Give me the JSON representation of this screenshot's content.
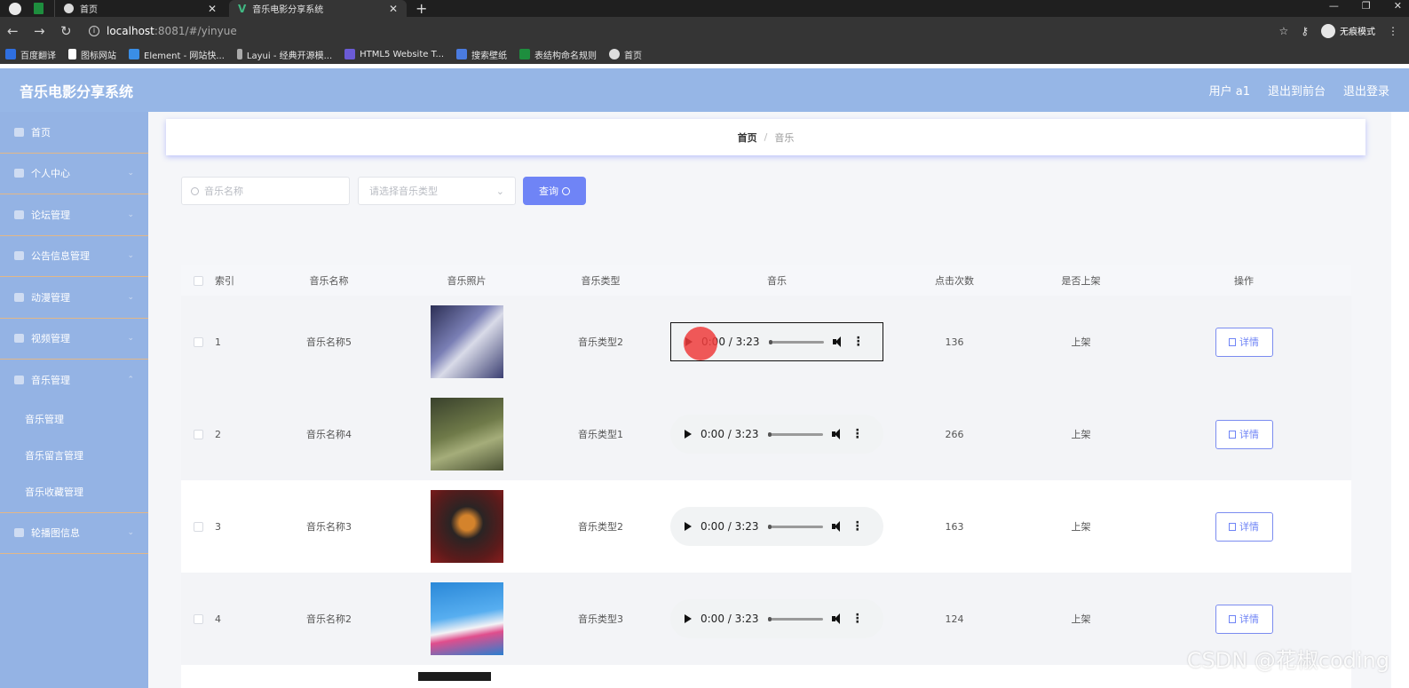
{
  "browser": {
    "tabs": [
      {
        "title": "首页"
      },
      {
        "title": "音乐电影分享系统"
      }
    ],
    "url_host": "localhost",
    "url_path": ":8081/#/yinyue",
    "incognito_label": "无痕模式",
    "bookmarks": [
      {
        "label": "百度翻译",
        "color": "#2f6fe0"
      },
      {
        "label": "图标网站",
        "color": "#ffffff"
      },
      {
        "label": "Element - 网站快...",
        "color": "#3a8ee6"
      },
      {
        "label": "Layui - 经典开源模...",
        "color": "#aaaaaa"
      },
      {
        "label": "HTML5 Website T...",
        "color": "#6b5bd6"
      },
      {
        "label": "搜索壁纸",
        "color": "#4a7be0"
      },
      {
        "label": "表结构命名规则",
        "color": "#1e8e3e"
      },
      {
        "label": "首页",
        "color": "#dddddd"
      }
    ]
  },
  "header": {
    "brand": "音乐电影分享系统",
    "user": "用户 a1",
    "to_front": "退出到前台",
    "logout": "退出登录"
  },
  "sidebar": {
    "items": [
      {
        "label": "首页",
        "arrow": false
      },
      {
        "label": "个人中心",
        "arrow": true
      },
      {
        "label": "论坛管理",
        "arrow": true
      },
      {
        "label": "公告信息管理",
        "arrow": true
      },
      {
        "label": "动漫管理",
        "arrow": true
      },
      {
        "label": "视频管理",
        "arrow": true
      },
      {
        "label": "音乐管理",
        "arrow": true
      }
    ],
    "sub_items": [
      "音乐管理",
      "音乐留言管理",
      "音乐收藏管理"
    ],
    "last_item": {
      "label": "轮播图信息"
    }
  },
  "breadcrumb": {
    "home": "首页",
    "sep": "/",
    "current": "音乐"
  },
  "search": {
    "name_placeholder": "音乐名称",
    "type_placeholder": "请选择音乐类型",
    "query_label": "查询"
  },
  "table": {
    "headers": [
      "索引",
      "音乐名称",
      "音乐照片",
      "音乐类型",
      "音乐",
      "点击次数",
      "是否上架",
      "操作"
    ],
    "rows": [
      {
        "index": "1",
        "name": "音乐名称5",
        "type": "音乐类型2",
        "time": "0:00 / 3:23",
        "clicks": "136",
        "shelf": "上架",
        "action": "详情"
      },
      {
        "index": "2",
        "name": "音乐名称4",
        "type": "音乐类型1",
        "time": "0:00 / 3:23",
        "clicks": "266",
        "shelf": "上架",
        "action": "详情"
      },
      {
        "index": "3",
        "name": "音乐名称3",
        "type": "音乐类型2",
        "time": "0:00 / 3:23",
        "clicks": "163",
        "shelf": "上架",
        "action": "详情"
      },
      {
        "index": "4",
        "name": "音乐名称2",
        "type": "音乐类型3",
        "time": "0:00 / 3:23",
        "clicks": "124",
        "shelf": "上架",
        "action": "详情"
      }
    ]
  },
  "watermark": "CSDN @花椒coding",
  "colors": {
    "header": "#96b6e6",
    "sidebar": "#94b3e4",
    "accent": "#6f84f6"
  }
}
